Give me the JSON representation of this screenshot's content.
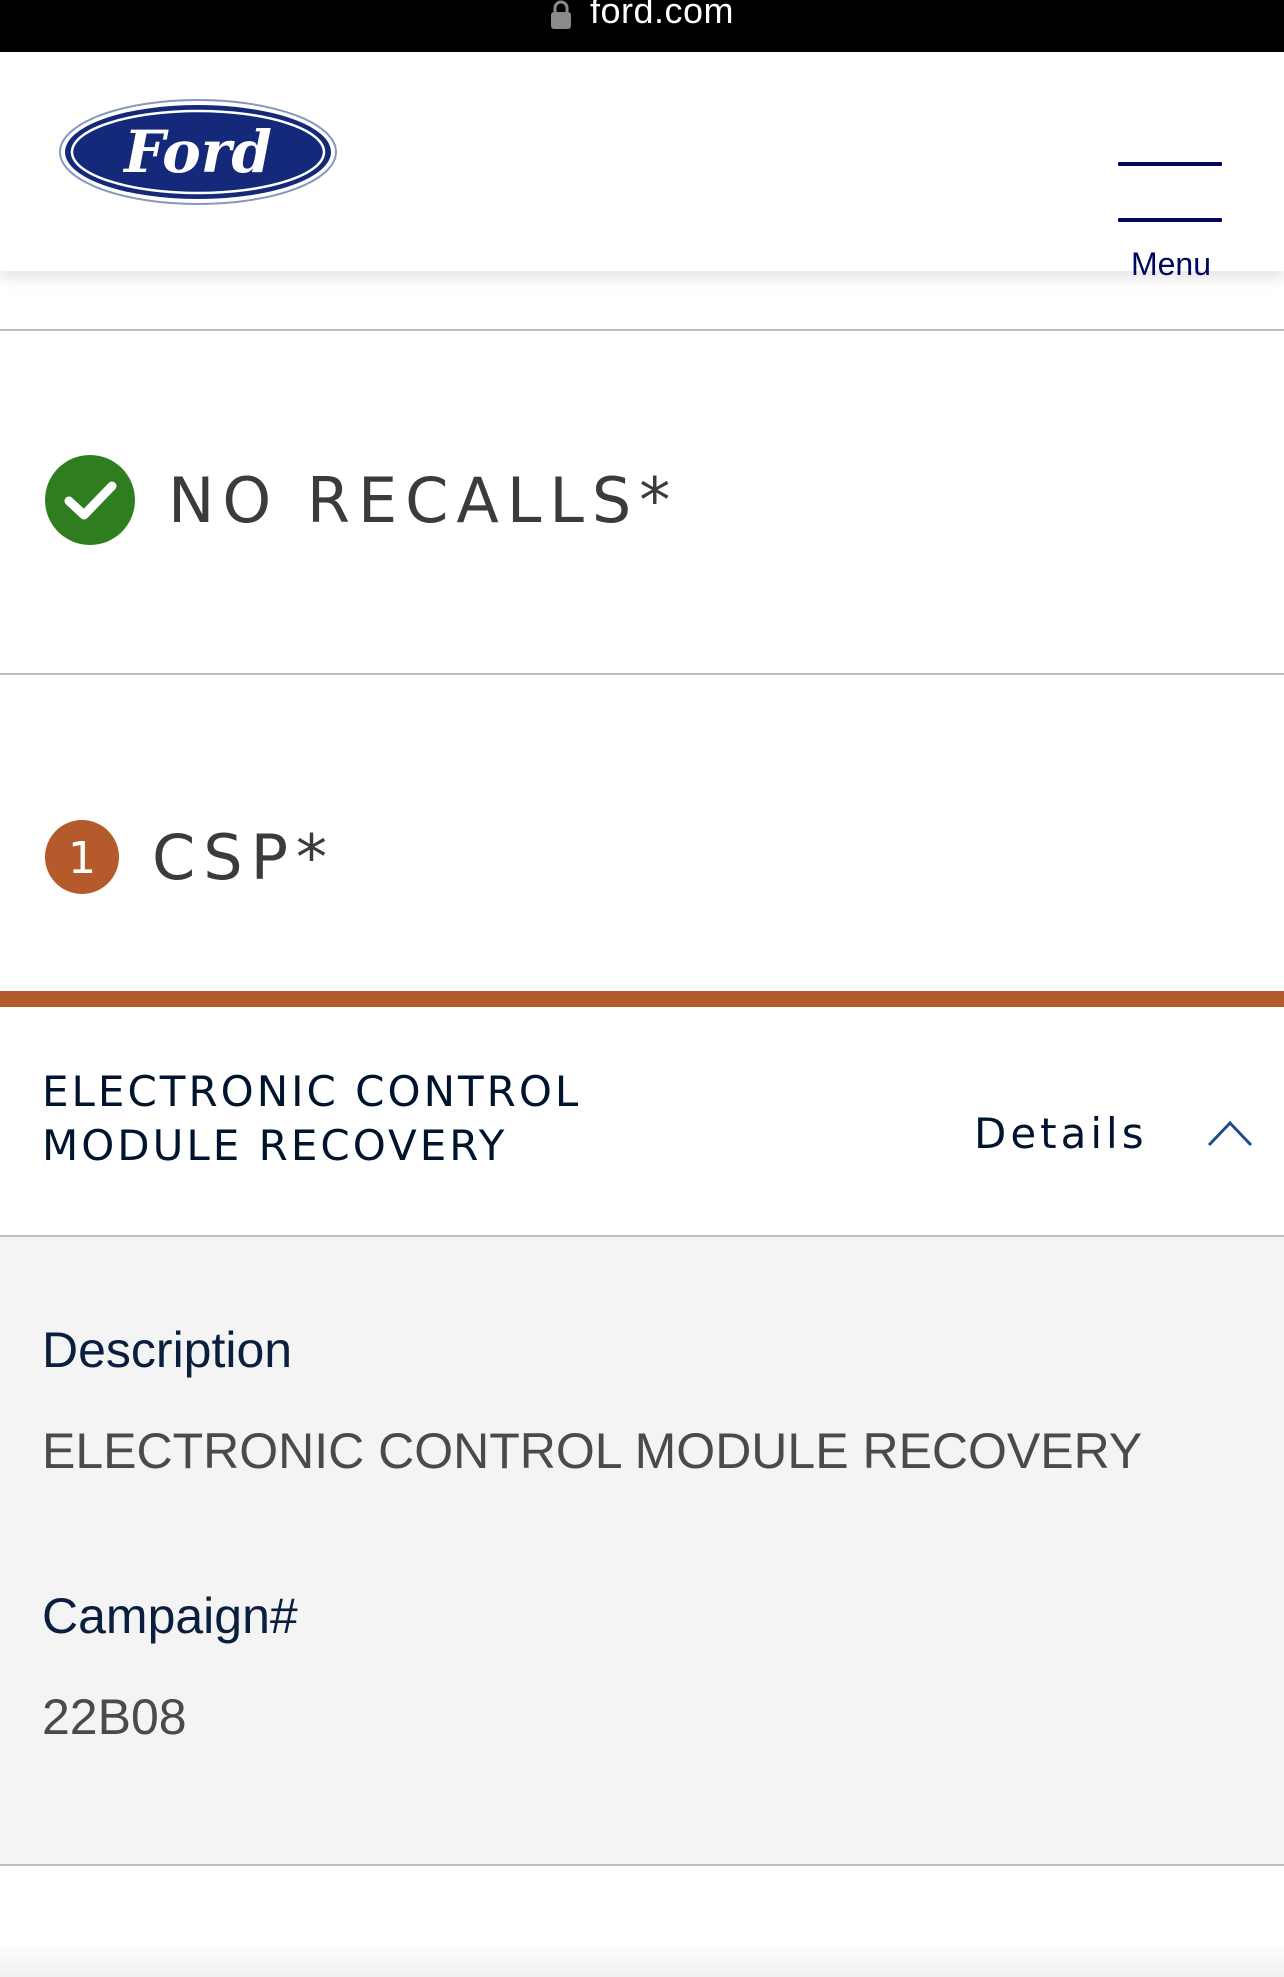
{
  "browser": {
    "url": "ford.com"
  },
  "header": {
    "logo_text": "Ford",
    "menu_label": "Menu",
    "brand_color": "#00095b"
  },
  "status": {
    "no_recalls": {
      "label": "NO RECALLS*",
      "icon": "check-circle-icon",
      "color": "#2e7d1e"
    },
    "csp": {
      "count": "1",
      "label": "CSP*",
      "icon": "count-badge",
      "color": "#b55a2a"
    }
  },
  "campaign": {
    "title": "ELECTRONIC CONTROL MODULE RECOVERY",
    "details_label": "Details",
    "expanded": true,
    "description_label": "Description",
    "description_value": "ELECTRONIC CONTROL MODULE RECOVERY",
    "campaign_label": "Campaign#",
    "campaign_value": "22B08"
  }
}
